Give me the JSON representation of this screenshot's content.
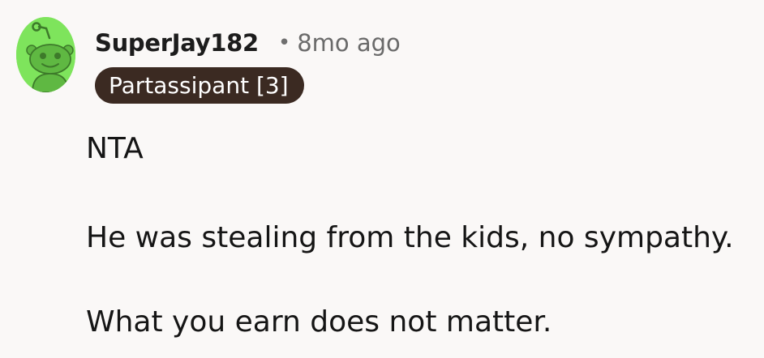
{
  "comment": {
    "avatar": {
      "icon": "reddit-snoo-icon",
      "background_color": "#7ee45c"
    },
    "author": "SuperJay182",
    "separator": "•",
    "timestamp": "8mo ago",
    "flair": {
      "label": "Partassipant [3]",
      "background_color": "#3b2a22"
    },
    "body": {
      "paragraphs": [
        "NTA",
        "He was stealing from the kids, no sympathy.",
        "What you earn does not matter."
      ]
    }
  }
}
